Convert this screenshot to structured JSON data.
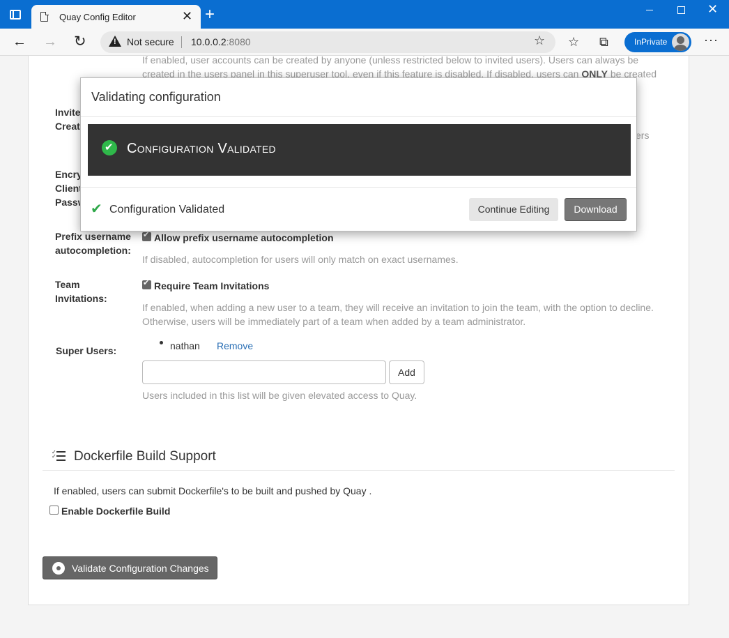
{
  "browser": {
    "tab_title": "Quay Config Editor",
    "security_label": "Not secure",
    "url_host": "10.0.0.2",
    "url_port": ":8080",
    "inprivate_label": "InPrivate"
  },
  "form": {
    "user_creation_help_line1": "If enabled, user accounts can be created by anyone (unless restricted below to invited users). Users can always be",
    "user_creation_help_line2_prefix": "created in the users panel in this superuser tool, even if this feature is disabled. If disabled, users can ",
    "user_creation_help_line2_bold": "ONLY",
    "user_creation_help_line2_suffix": " be created",
    "invite_label_line1": "Invite",
    "invite_label_line2": "Creat",
    "invite_help_tail": "ers",
    "encrypted_label_line1": "Encry",
    "encrypted_label_line2": "Client",
    "encrypted_label_line3": "Passw",
    "prefix_label_line1": "Prefix username",
    "prefix_label_line2": "autocompletion:",
    "prefix_checkbox_label": "Allow prefix username autocompletion",
    "prefix_checked": true,
    "prefix_help": "If disabled, autocompletion for users will only match on exact usernames.",
    "team_label_line1": "Team",
    "team_label_line2": "Invitations:",
    "team_checkbox_label": "Require Team Invitations",
    "team_checked": true,
    "team_help_line1": "If enabled, when adding a new user to a team, they will receive an invitation to join the team, with the option to decline.",
    "team_help_line2": "Otherwise, users will be immediately part of a team when added by a team administrator.",
    "super_users_label": "Super Users:",
    "super_users": [
      {
        "name": "nathan",
        "remove_label": "Remove"
      }
    ],
    "super_user_input_value": "",
    "add_button_label": "Add",
    "super_users_help": "Users included in this list will be given elevated access to Quay."
  },
  "dockerfile_section": {
    "title": "Dockerfile Build Support",
    "help": "If enabled, users can submit Dockerfile's to be built and pushed by Quay .",
    "checkbox_label": "Enable Dockerfile Build",
    "checked": false
  },
  "validate_button_label": "Validate Configuration Changes",
  "modal": {
    "title": "Validating configuration",
    "banner_text": "Configuration Validated",
    "footer_status": "Configuration Validated",
    "continue_label": "Continue Editing",
    "download_label": "Download"
  },
  "colors": {
    "chrome_blue": "#0a6ed1",
    "success_green": "#2fb84a",
    "banner_bg": "#333333",
    "link_blue": "#2a6fb5"
  }
}
